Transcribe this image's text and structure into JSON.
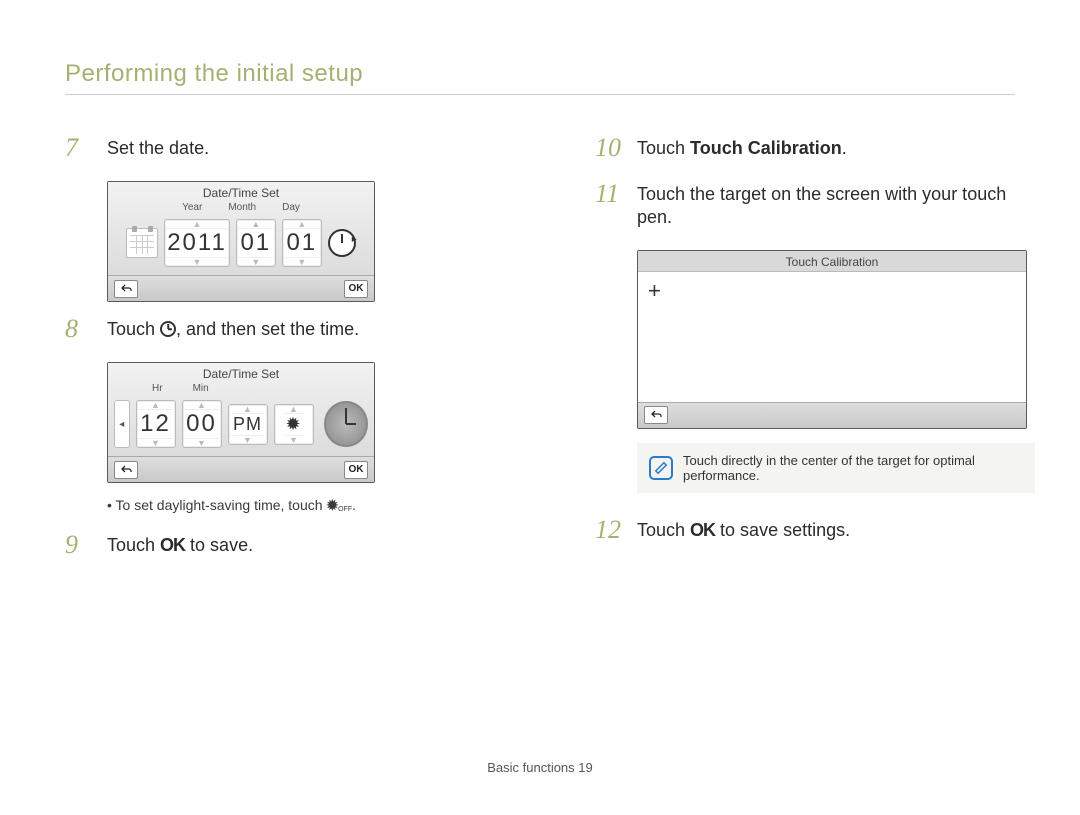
{
  "header": {
    "title": "Performing the initial setup"
  },
  "left": {
    "step7": {
      "num": "7",
      "text": "Set the date."
    },
    "date_screen": {
      "title": "Date/Time Set",
      "labels": {
        "year": "Year",
        "month": "Month",
        "day": "Day"
      },
      "values": {
        "year": "2011",
        "month": "01",
        "day": "01"
      },
      "ok": "OK"
    },
    "step8": {
      "num": "8",
      "pre": "Touch ",
      "post": ", and then set the time."
    },
    "time_screen": {
      "title": "Date/Time Set",
      "labels": {
        "hr": "Hr",
        "min": "Min"
      },
      "values": {
        "hr": "12",
        "min": "00",
        "ampm": "PM"
      },
      "ok": "OK"
    },
    "bullet8": {
      "pre": "To set daylight-saving time, touch ",
      "icon": "✹",
      "post": "."
    },
    "step9": {
      "num": "9",
      "pre": "Touch ",
      "ok": "OK",
      "post": " to save."
    }
  },
  "right": {
    "step10": {
      "num": "10",
      "pre": "Touch ",
      "bold": "Touch Calibration",
      "post": "."
    },
    "step11": {
      "num": "11",
      "text": "Touch the target on the screen with your touch pen."
    },
    "calib_screen": {
      "title": "Touch Calibration",
      "target": "+"
    },
    "note": {
      "text": "Touch directly in the center of the target for optimal performance."
    },
    "step12": {
      "num": "12",
      "pre": "Touch ",
      "ok": "OK",
      "post": " to save settings."
    }
  },
  "footer": {
    "label": "Basic functions  ",
    "page": "19"
  }
}
